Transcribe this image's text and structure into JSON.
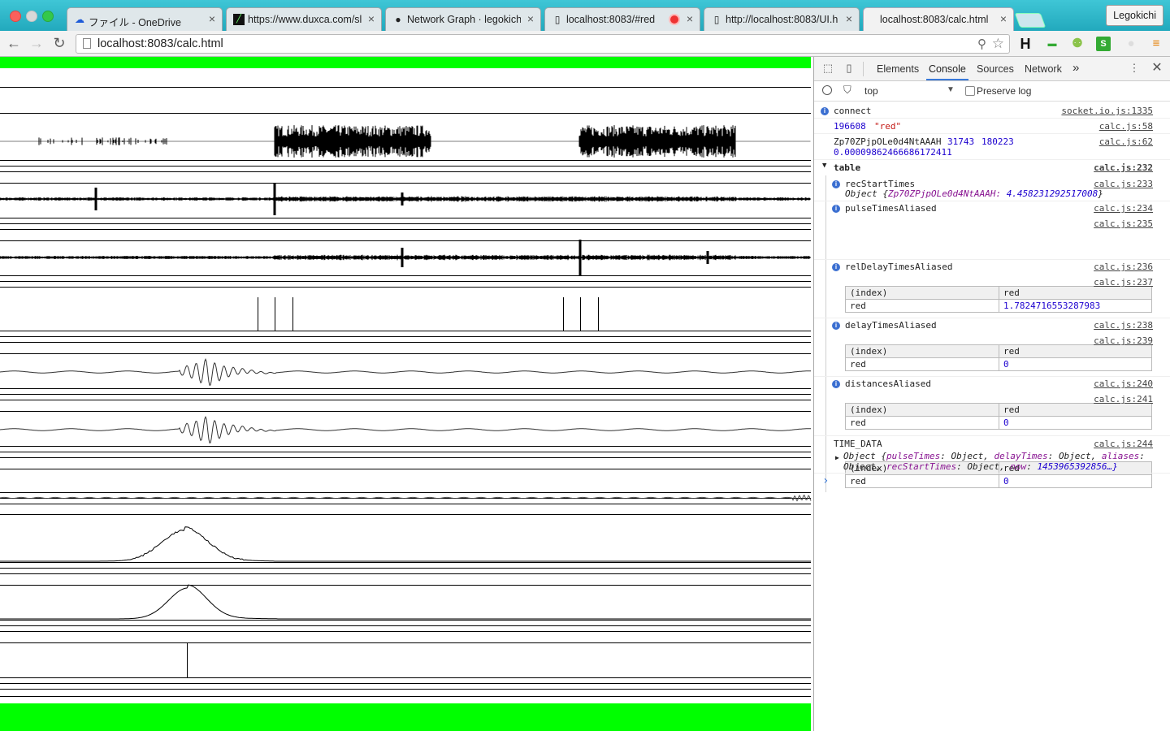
{
  "window": {
    "profile_name": "Legokichi"
  },
  "tabs": [
    {
      "title": "ファイル - OneDrive",
      "icon": "onedrive-cloud-icon",
      "active": false
    },
    {
      "title": "https://www.duxca.com/sl",
      "icon": "site-favicon",
      "active": false
    },
    {
      "title": "Network Graph · legokichi/",
      "icon": "github-icon",
      "active": false
    },
    {
      "title": "localhost:8083/#red",
      "icon": "page-icon",
      "active": false,
      "recording": true
    },
    {
      "title": "http://localhost:8083/UI.h",
      "icon": "page-icon",
      "active": false
    },
    {
      "title": "localhost:8083/calc.html",
      "icon": "page-icon",
      "active": true
    }
  ],
  "toolbar": {
    "url": "localhost:8083/calc.html"
  },
  "colors": {
    "page_green": "#00ff00",
    "info_blue": "#3b6fd1",
    "tab_accent": "#3879d9"
  },
  "devtools": {
    "tabs": [
      "Elements",
      "Console",
      "Sources",
      "Network"
    ],
    "more_tabs": "»",
    "context": "top",
    "preserve_log": "Preserve log",
    "console": {
      "connect": {
        "text": "connect",
        "src": "socket.io.js:1335"
      },
      "log_red": {
        "num": "196608",
        "str": "\"red\"",
        "src": "calc.js:58"
      },
      "log_id": {
        "id": "Zp70ZPjpOLe0d4NtAAAH",
        "n1": "31743",
        "n2": "180223",
        "n3": "0.00009862466686172411",
        "src": "calc.js:62"
      },
      "group": {
        "label": "table",
        "src": "calc.js:232"
      },
      "rec_start": {
        "label": "recStartTimes",
        "src": "calc.js:233",
        "obj_prefix": "Object {",
        "obj_key": "Zp70ZPjpOLe0d4NtAAAH",
        "obj_val": "4.458231292517008",
        "obj_suffix": "}"
      },
      "pulse": {
        "label": "pulseTimesAliased",
        "src": "calc.js:234",
        "table_src": "calc.js:235",
        "head": [
          "(index)",
          "red"
        ],
        "row": [
          "red",
          "1.7824716553287983"
        ]
      },
      "reldelay": {
        "label": "relDelayTimesAliased",
        "src": "calc.js:236",
        "table_src": "calc.js:237",
        "head": [
          "(index)",
          "red"
        ],
        "row": [
          "red",
          "0"
        ]
      },
      "delay": {
        "label": "delayTimesAliased",
        "src": "calc.js:238",
        "table_src": "calc.js:239",
        "head": [
          "(index)",
          "red"
        ],
        "row": [
          "red",
          "0"
        ]
      },
      "dist": {
        "label": "distancesAliased",
        "src": "calc.js:240",
        "table_src": "calc.js:241",
        "head": [
          "(index)",
          "red"
        ],
        "row": [
          "red",
          "0"
        ]
      },
      "time_data": {
        "label": "TIME_DATA",
        "src": "calc.js:244",
        "line1_prefix": "Object {",
        "k1": "pulseTimes",
        "v1": "Object,",
        "k2": "delayTimes",
        "v2": "Object,",
        "k3": "aliases",
        "v3": ":",
        "line2_prefix": "Object,",
        "k4": "recStartTimes",
        "v4": "Object,",
        "k5": "now",
        "v5": "1453965392856…}"
      },
      "prompt": "›"
    }
  },
  "page": {
    "rows": [
      {
        "name": "signal-row-1-recording",
        "kind": "wave"
      },
      {
        "name": "signal-row-2-filtered",
        "kind": "wave"
      },
      {
        "name": "signal-row-3-filtered",
        "kind": "wave"
      },
      {
        "name": "signal-row-4-pulse-markers",
        "kind": "markers"
      },
      {
        "name": "signal-row-5-correlation",
        "kind": "wave"
      },
      {
        "name": "signal-row-6-correlation",
        "kind": "wave"
      },
      {
        "name": "signal-row-7-flat",
        "kind": "wave"
      },
      {
        "name": "signal-row-8-envelope",
        "kind": "curve"
      },
      {
        "name": "signal-row-9-envelope",
        "kind": "curve"
      },
      {
        "name": "signal-row-10-peak",
        "kind": "impulse"
      }
    ]
  }
}
